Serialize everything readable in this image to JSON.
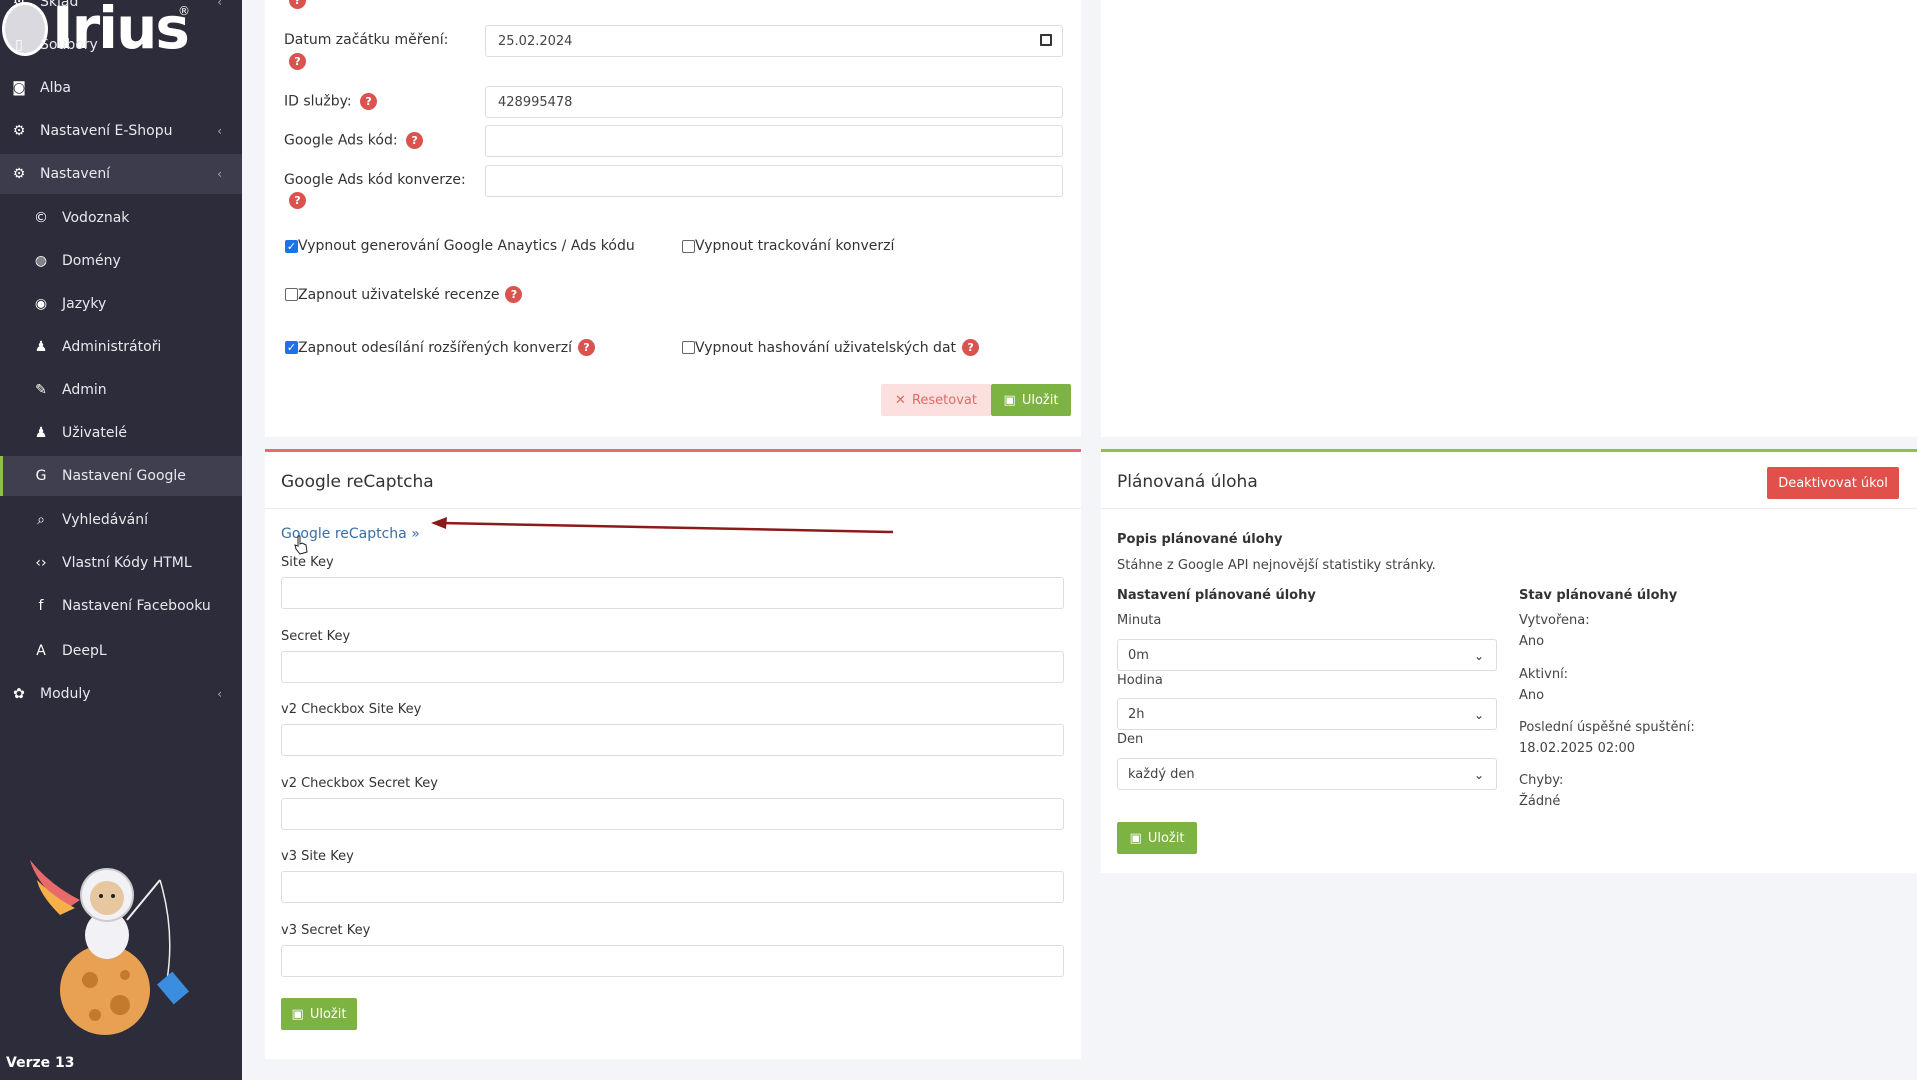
{
  "brand": {
    "name": "Irius",
    "reg": "®"
  },
  "sidebar": {
    "items": [
      {
        "label": "Sklad",
        "icon": "boxes-icon",
        "glyph": "⚙",
        "level": 1,
        "chevron": true
      },
      {
        "label": "Soubory",
        "icon": "file-icon",
        "glyph": "▯",
        "level": 1,
        "chevron": false
      },
      {
        "label": "Alba",
        "icon": "camera-icon",
        "glyph": "◙",
        "level": 1,
        "chevron": false
      },
      {
        "label": "Nastavení E-Shopu",
        "icon": "cogs-icon",
        "glyph": "⚙",
        "level": 1,
        "chevron": true
      },
      {
        "label": "Nastavení",
        "icon": "cogs-icon",
        "glyph": "⚙",
        "level": 1,
        "chevron": true,
        "state": "open"
      },
      {
        "label": "Vodoznak",
        "icon": "copyright-icon",
        "glyph": "©",
        "level": 2
      },
      {
        "label": "Domény",
        "icon": "globe-icon",
        "glyph": "◍",
        "level": 2
      },
      {
        "label": "Jazyky",
        "icon": "language-icon",
        "glyph": "◉",
        "level": 2
      },
      {
        "label": "Administrátoři",
        "icon": "user-tie-icon",
        "glyph": "♟",
        "level": 2
      },
      {
        "label": "Admin",
        "icon": "wrench-icon",
        "glyph": "✎",
        "level": 2
      },
      {
        "label": "Uživatelé",
        "icon": "user-icon",
        "glyph": "♟",
        "level": 2
      },
      {
        "label": "Nastavení Google",
        "icon": "google-icon",
        "glyph": "G",
        "level": 2,
        "state": "active"
      },
      {
        "label": "Vyhledávání",
        "icon": "search-icon",
        "glyph": "⌕",
        "level": 2
      },
      {
        "label": "Vlastní Kódy HTML",
        "icon": "html-icon",
        "glyph": "‹›",
        "level": 2
      },
      {
        "label": "Nastavení Facebooku",
        "icon": "facebook-icon",
        "glyph": "f",
        "level": 2
      },
      {
        "label": "DeepL",
        "icon": "translate-icon",
        "glyph": "A",
        "level": 2
      },
      {
        "label": "Moduly",
        "icon": "puzzle-icon",
        "glyph": "✿",
        "level": 1,
        "chevron": true
      }
    ],
    "version": "Verze 13"
  },
  "analytics": {
    "date_label": "Datum začátku měření:",
    "date_value": "25.02.2024",
    "service_id_label": "ID služby:",
    "service_id_value": "428995478",
    "ads_code_label": "Google Ads kód:",
    "ads_code_value": "",
    "ads_conv_label": "Google Ads kód konverze:",
    "ads_conv_value": "",
    "checkboxes": [
      {
        "label": "Vypnout generování Google Anaytics / Ads kódu",
        "checked": true
      },
      {
        "label": "Vypnout trackování konverzí",
        "checked": false
      },
      {
        "label": "Zapnout uživatelské recenze",
        "checked": false
      },
      {
        "label": "Zapnout odesílání rozšířených konverzí",
        "checked": true
      },
      {
        "label": "Vypnout hashování uživatelských dat",
        "checked": false
      }
    ],
    "reset_label": "Resetovat",
    "save_label": "Uložit"
  },
  "recaptcha": {
    "title": "Google reCaptcha",
    "link": "Google reCaptcha »",
    "fields": [
      {
        "label": "Site Key",
        "value": ""
      },
      {
        "label": "Secret Key",
        "value": ""
      },
      {
        "label": "v2 Checkbox Site Key",
        "value": ""
      },
      {
        "label": "v2 Checkbox Secret Key",
        "value": ""
      },
      {
        "label": "v3 Site Key",
        "value": ""
      },
      {
        "label": "v3 Secret Key",
        "value": ""
      }
    ],
    "save_label": "Uložit"
  },
  "task": {
    "title": "Plánovaná úloha",
    "deactivate_label": "Deaktivovat úkol",
    "desc_heading": "Popis plánované úlohy",
    "desc_text": "Stáhne z Google API nejnovější statistiky stránky.",
    "settings_heading": "Nastavení plánované úlohy",
    "minute_label": "Minuta",
    "minute_value": "0m",
    "hour_label": "Hodina",
    "hour_value": "2h",
    "day_label": "Den",
    "day_value": "každý den",
    "save_label": "Uložit",
    "status_heading": "Stav plánované úlohy",
    "created_label": "Vytvořena:",
    "created_value": "Ano",
    "active_label": "Aktivní:",
    "active_value": "Ano",
    "last_run_label": "Poslední úspěšné spuštění:",
    "last_run_value": "18.02.2025 02:00",
    "errors_label": "Chyby:",
    "errors_value": "Žádné"
  },
  "colors": {
    "sidebar_bg": "#2c2c3a",
    "accent_green": "#7cb342",
    "danger": "#e2504c",
    "link": "#3a6ea5",
    "annotation_arrow": "#8b1a1a"
  }
}
